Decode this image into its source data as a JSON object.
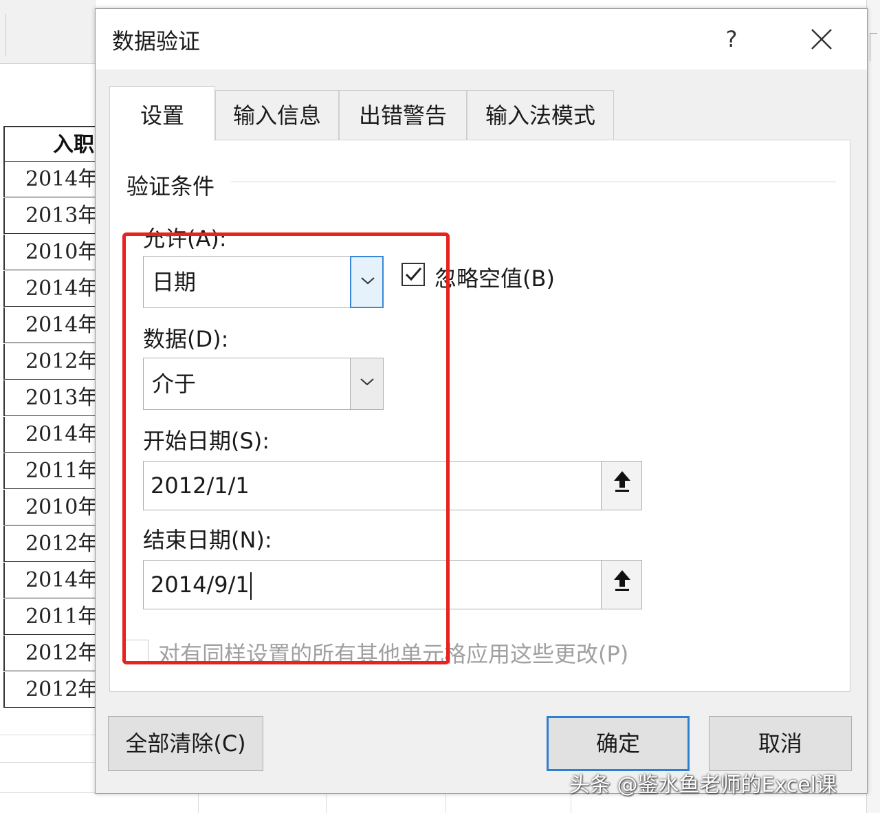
{
  "sheet": {
    "header": "入职",
    "rows": [
      "2014年",
      "2013年",
      "2010年",
      "2014年",
      "2014年",
      "2012年",
      "2013年",
      "2014年",
      "2011年",
      "2010年",
      "2012年",
      "2014年",
      "2011年",
      "2012年",
      "2012年"
    ]
  },
  "dialog": {
    "title": "数据验证",
    "help_label": "?",
    "tabs": [
      "设置",
      "输入信息",
      "出错警告",
      "输入法模式"
    ],
    "group_title": "验证条件",
    "allow": {
      "label": "允许(A):",
      "value": "日期"
    },
    "ignore_blank": {
      "label": "忽略空值(B)",
      "checked": true
    },
    "data": {
      "label": "数据(D):",
      "value": "介于"
    },
    "start_date": {
      "label": "开始日期(S):",
      "value": "2012/1/1"
    },
    "end_date": {
      "label": "结束日期(N):",
      "value": "2014/9/1"
    },
    "apply_all": {
      "label": "对有同样设置的所有其他单元格应用这些更改(P)",
      "checked": false
    },
    "buttons": {
      "clear_all": "全部清除(C)",
      "ok": "确定",
      "cancel": "取消"
    }
  },
  "colors": {
    "highlight": "#e6231f",
    "focus_blue": "#2f7fd0"
  },
  "watermark": "头条 @鉴水鱼老师的Excel课"
}
